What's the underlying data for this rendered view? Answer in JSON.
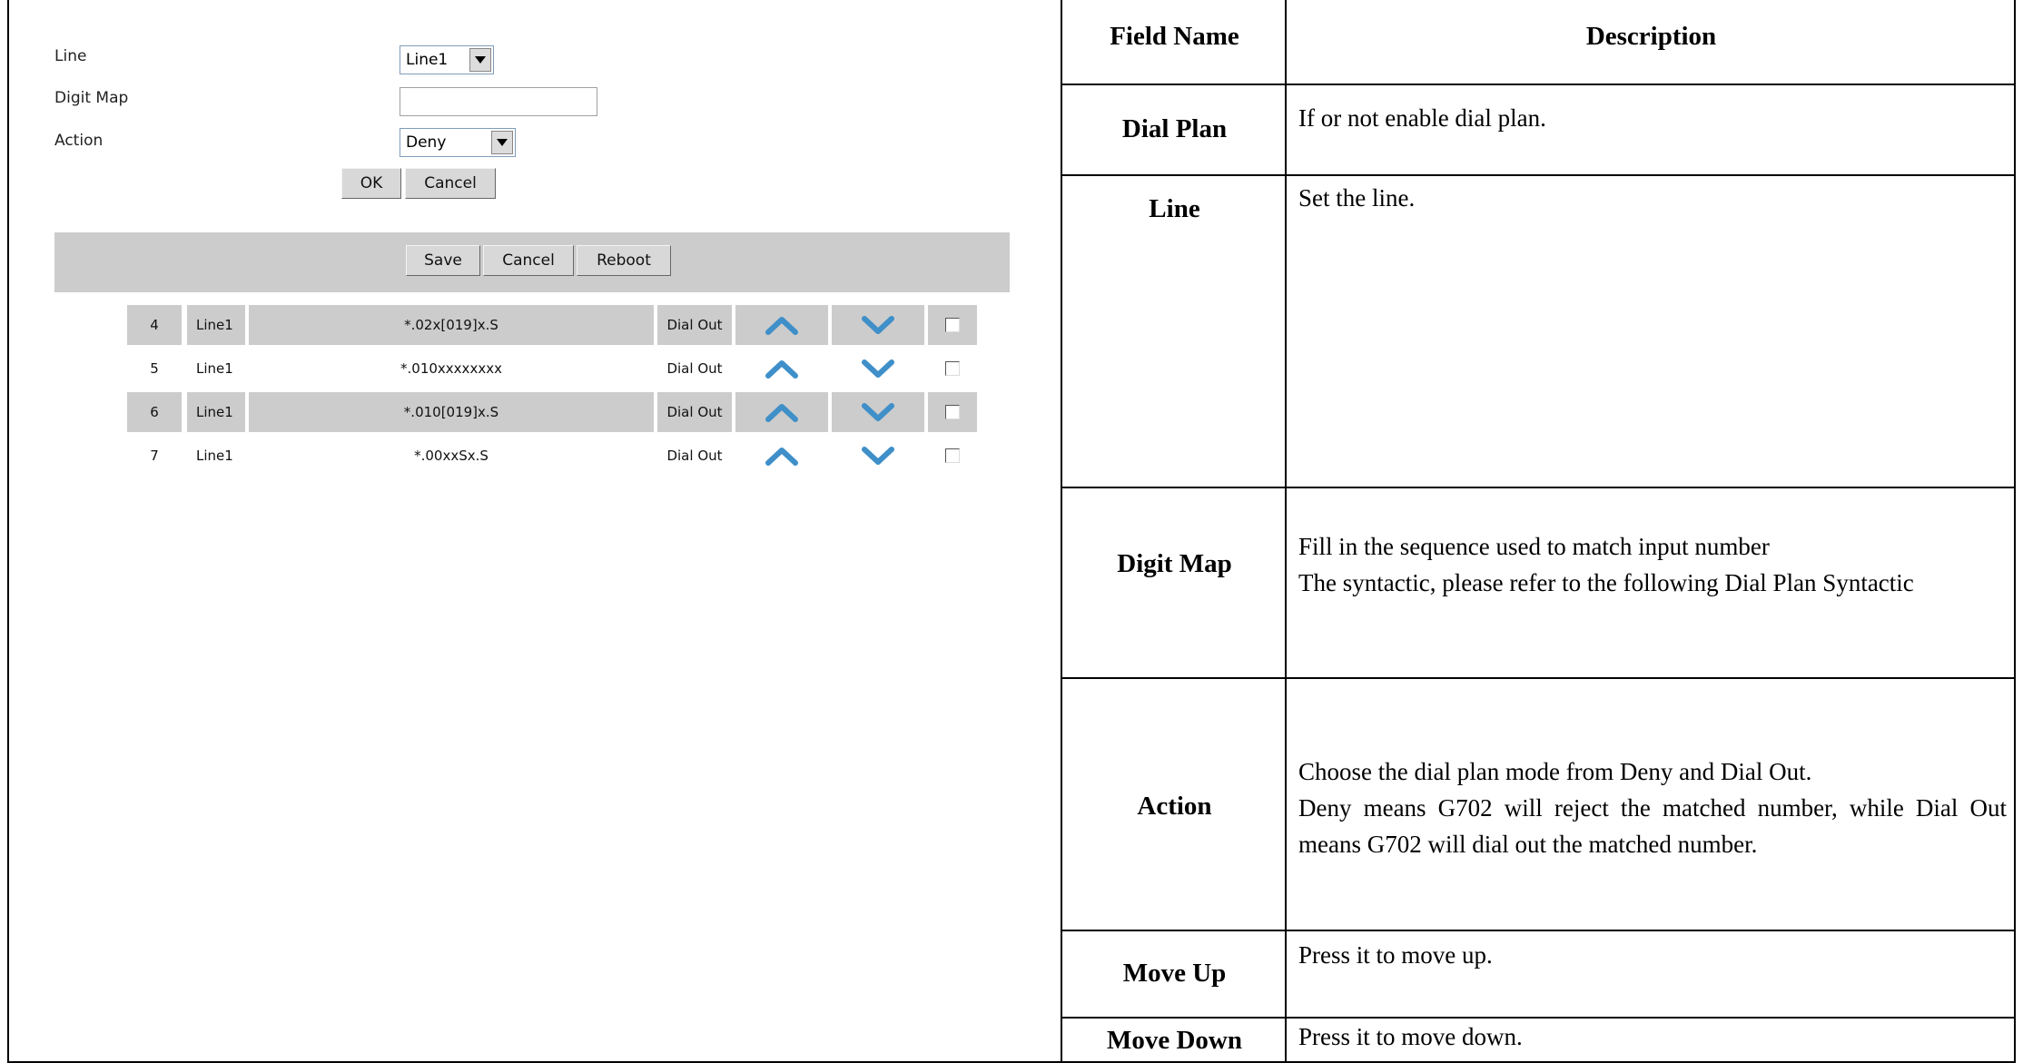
{
  "form": {
    "line_label": "Line",
    "line_value": "Line1",
    "digitmap_label": "Digit Map",
    "digitmap_value": "",
    "action_label": "Action",
    "action_value": "Deny",
    "ok_label": "OK",
    "cancel_label": "Cancel"
  },
  "toolbar": {
    "save_label": "Save",
    "cancel_label": "Cancel",
    "reboot_label": "Reboot"
  },
  "rules": [
    {
      "index": "4",
      "line": "Line1",
      "pattern": "*.02x[019]x.S",
      "action": "Dial Out",
      "checked": false
    },
    {
      "index": "5",
      "line": "Line1",
      "pattern": "*.010xxxxxxxx",
      "action": "Dial Out",
      "checked": false
    },
    {
      "index": "6",
      "line": "Line1",
      "pattern": "*.010[019]x.S",
      "action": "Dial Out",
      "checked": false
    },
    {
      "index": "7",
      "line": "Line1",
      "pattern": "*.00xxSx.S",
      "action": "Dial Out",
      "checked": false
    }
  ],
  "colors": {
    "chevron_blue": "#3f8fc9",
    "row_shade": "#cccccc",
    "toolbar_bg": "#cccccc"
  },
  "table": {
    "header": {
      "field": "Field Name",
      "description": "Description"
    },
    "rows": [
      {
        "field": "Dial Plan",
        "description": [
          "If or not enable dial plan."
        ]
      },
      {
        "field": "Line",
        "description": [
          "Set the line."
        ]
      },
      {
        "field": "Digit Map",
        "description": [
          "Fill in the sequence used to match input number",
          "The syntactic, please refer to the following Dial Plan Syntactic"
        ]
      },
      {
        "field": "Action",
        "description": [
          "Choose the dial plan mode from Deny and Dial Out.",
          "Deny means G702 will reject the matched number, while Dial Out means G702 will dial out the matched number."
        ]
      },
      {
        "field": "Move Up",
        "description": [
          "Press it to move up."
        ]
      },
      {
        "field": "Move Down",
        "description": [
          "Press it to move down."
        ]
      }
    ]
  }
}
